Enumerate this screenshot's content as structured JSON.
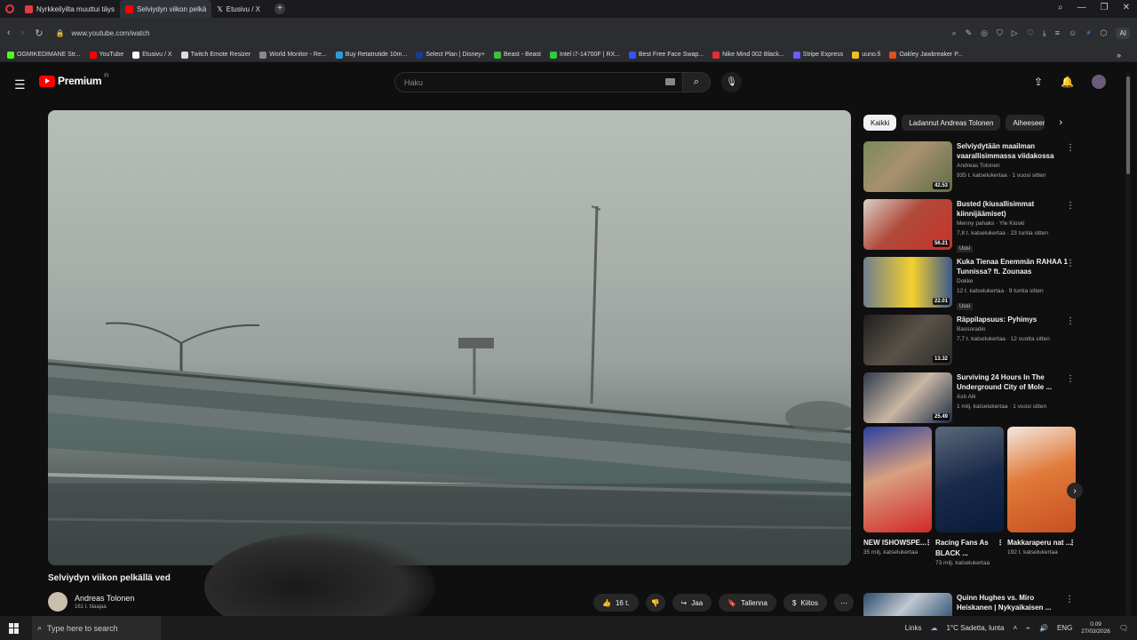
{
  "browser": {
    "tabs": [
      {
        "label": "Nyrkkeilyilta muuttui täys",
        "color": "#e23b3b"
      },
      {
        "label": "Selviydyn viikon pelkä",
        "color": "#ff0000"
      },
      {
        "label": "Etusivu / X",
        "color": "#ffffff"
      }
    ],
    "url": "www.youtube.com/watch",
    "ai_label": "AI",
    "bookmarks": [
      {
        "label": "OGMIKEDIMANE Str...",
        "color": "#53fc18"
      },
      {
        "label": "YouTube",
        "color": "#ff0000"
      },
      {
        "label": "Etusivu / X",
        "color": "#ffffff"
      },
      {
        "label": "Twitch Emote Resizer",
        "color": "#dddddd"
      },
      {
        "label": "World Monitor - Re...",
        "color": "#888888"
      },
      {
        "label": "Buy Retatrutide 10m...",
        "color": "#2aa0d8"
      },
      {
        "label": "Select Plan | Disney+",
        "color": "#1a3c8f"
      },
      {
        "label": "Beast - Beast",
        "color": "#3fbf3f"
      },
      {
        "label": "Intel i7-14700F | RX...",
        "color": "#2ecc40"
      },
      {
        "label": "Best Free Face Swap...",
        "color": "#3355ff"
      },
      {
        "label": "Nike Mind 002 Black...",
        "color": "#e03030"
      },
      {
        "label": "Stripe Express",
        "color": "#6a5bff"
      },
      {
        "label": "uuno.fi",
        "color": "#f0c020"
      },
      {
        "label": "Oakley Jawbreaker P...",
        "color": "#e05020"
      }
    ]
  },
  "youtube": {
    "logo_text": "Premium",
    "logo_region": "FI",
    "search_placeholder": "Haku"
  },
  "video": {
    "title": "Selviydyn viikon pelkällä ved",
    "channel": "Andreas Tolonen",
    "subscribers": "161 t. tilaajaa",
    "likes": "16 t.",
    "share_label": "Jaa",
    "save_label": "Tallenna",
    "thanks_label": "Kiitos"
  },
  "chips": [
    "Kaikki",
    "Ladannut Andreas Tolonen",
    "Aiheeseen"
  ],
  "recommendations": [
    {
      "title": "Selviydytään maailman vaarallisimmassa viidakossa",
      "channel": "Andreas Tolonen",
      "meta": "935 t. katselukertaa · 1 vuosi sitten",
      "duration": "42.53",
      "badge": "",
      "thumb": "linear-gradient(135deg,#7a8a5c,#a89070 45%,#5d6e46)"
    },
    {
      "title": "Busted (kiusallisimmat kiinnijäämiset)",
      "channel": "Menny pahaks · Yle Kioski",
      "meta": "7,8 t. katselukertaa · 23 tuntia sitten",
      "duration": "56.21",
      "badge": "Uusi",
      "thumb": "linear-gradient(135deg,#d9d2c9,#b04a3a 45%,#c8322a)"
    },
    {
      "title": "Kuka Tienaa Enemmän RAHAA 1 Tunnissa? ft. Zounaas",
      "channel": "Dokke",
      "meta": "12 t. katselukertaa · 9 tuntia sitten",
      "duration": "22.01",
      "badge": "Uusi",
      "thumb": "linear-gradient(90deg,#6f7f8c,#f3d030 55%,#3c5a8a)"
    },
    {
      "title": "Räppilapsuus: Pyhimys",
      "channel": "Bassoradio",
      "meta": "7,7 t. katselukertaa · 12 vuotta sitten",
      "duration": "13.32",
      "badge": "",
      "thumb": "linear-gradient(135deg,#1e1e1e,#5a5248 50%,#2a2a2a)"
    },
    {
      "title": "Surviving 24 Hours In The Underground City of Mole ...",
      "channel": "Ash Alk",
      "meta": "1 milj. katselukertaa · 1 vuosi sitten",
      "duration": "25.49",
      "badge": "",
      "thumb": "linear-gradient(135deg,#2e3b4a,#c9b6a3 50%,#1c2a45)"
    }
  ],
  "shorts": [
    {
      "title": "NEW ISHOWSPE...",
      "views": "35 milj. katselukertaa",
      "thumb": "linear-gradient(160deg,#2a3fa0,#d8a080 45%,#d22828)"
    },
    {
      "title": "Racing Fans As BLACK ...",
      "views": "73 milj. katselukertaa",
      "thumb": "linear-gradient(160deg,#5a6a7a,#1a2a4a 50%,#0a1a3a)"
    },
    {
      "title": "Makkaraperu nat ...",
      "views": "192 t. katselukertaa",
      "thumb": "linear-gradient(160deg,#f3e8e0,#e07a3a 45%,#c85020)"
    }
  ],
  "last_recommendation": {
    "title": "Quinn Hughes vs. Miro Heiskanen | Nykyaikaisen ...",
    "thumb": "linear-gradient(135deg,#2a4a6a,#c0c8d0 50%,#3a5a7a)"
  },
  "taskbar": {
    "search_placeholder": "Type here to search",
    "links_label": "Links",
    "weather": "1°C  Sadetta, lunta",
    "lang": "ENG",
    "time": "0.09",
    "date": "27/03/2026"
  }
}
